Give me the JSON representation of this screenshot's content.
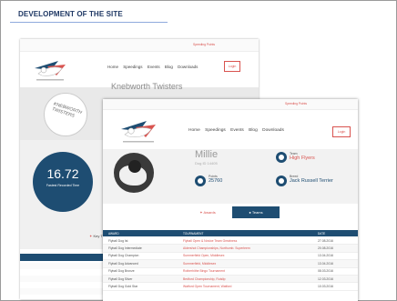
{
  "section": {
    "title": "DEVELOPMENT OF THE SITE"
  },
  "site": {
    "nav": [
      "Home",
      "Speedings",
      "Events",
      "Blog",
      "Downloads"
    ],
    "login_label": "Login",
    "topbar_text": "Speeding Points",
    "colors": {
      "navy": "#1e4d72",
      "red": "#d9534f"
    }
  },
  "back_page": {
    "team_name": "Knebworth Twisters",
    "badge_text": "KNEBWORTH TWISTERS",
    "fastest_time": "16.72",
    "fastest_label": "Fastest Recorded Time",
    "tab_label": "Key Trophies"
  },
  "front_page": {
    "dog_name": "Millie",
    "dog_sub": "Dog ID 14405",
    "stats": [
      {
        "label": "Team",
        "value": "High Flyers",
        "accent": "red"
      },
      {
        "label": "Points",
        "value": "25760",
        "accent": "navy"
      },
      {
        "label": "Breed",
        "value": "Jack Russell Terrier",
        "accent": "navy"
      }
    ],
    "tabs": [
      "Awards",
      "Teams"
    ],
    "table_headers": [
      "AWARD",
      "TOURNAMENT",
      "DATE"
    ],
    "rows": [
      {
        "award": "Flyball Dog Ist",
        "tournament": "Flyball Open & Novice Team Greatness",
        "date": "27.08.2016"
      },
      {
        "award": "Flyball Dog Intermediate",
        "tournament": "Aldershot Championships, Northumb. Superleem",
        "date": "20.08.2016"
      },
      {
        "award": "Flyball Dog Champion",
        "tournament": "Summerfield Open, Middlesex",
        "date": "13.04.2016"
      },
      {
        "award": "Flyball Dog Advanced",
        "tournament": "Summerfield, Middlesex",
        "date": "13.04.2016"
      },
      {
        "award": "Flyball Dog Bronze",
        "tournament": "Rotherhithe Bingo Tournament",
        "date": "08.03.2016"
      },
      {
        "award": "Flyball Dog Silver",
        "tournament": "Bedford Championship, Ruislip",
        "date": "12.03.2016"
      },
      {
        "award": "Flyball Dog Gold Star",
        "tournament": "Watford Open Tournament, Watford",
        "date": "10.03.2016"
      }
    ]
  }
}
